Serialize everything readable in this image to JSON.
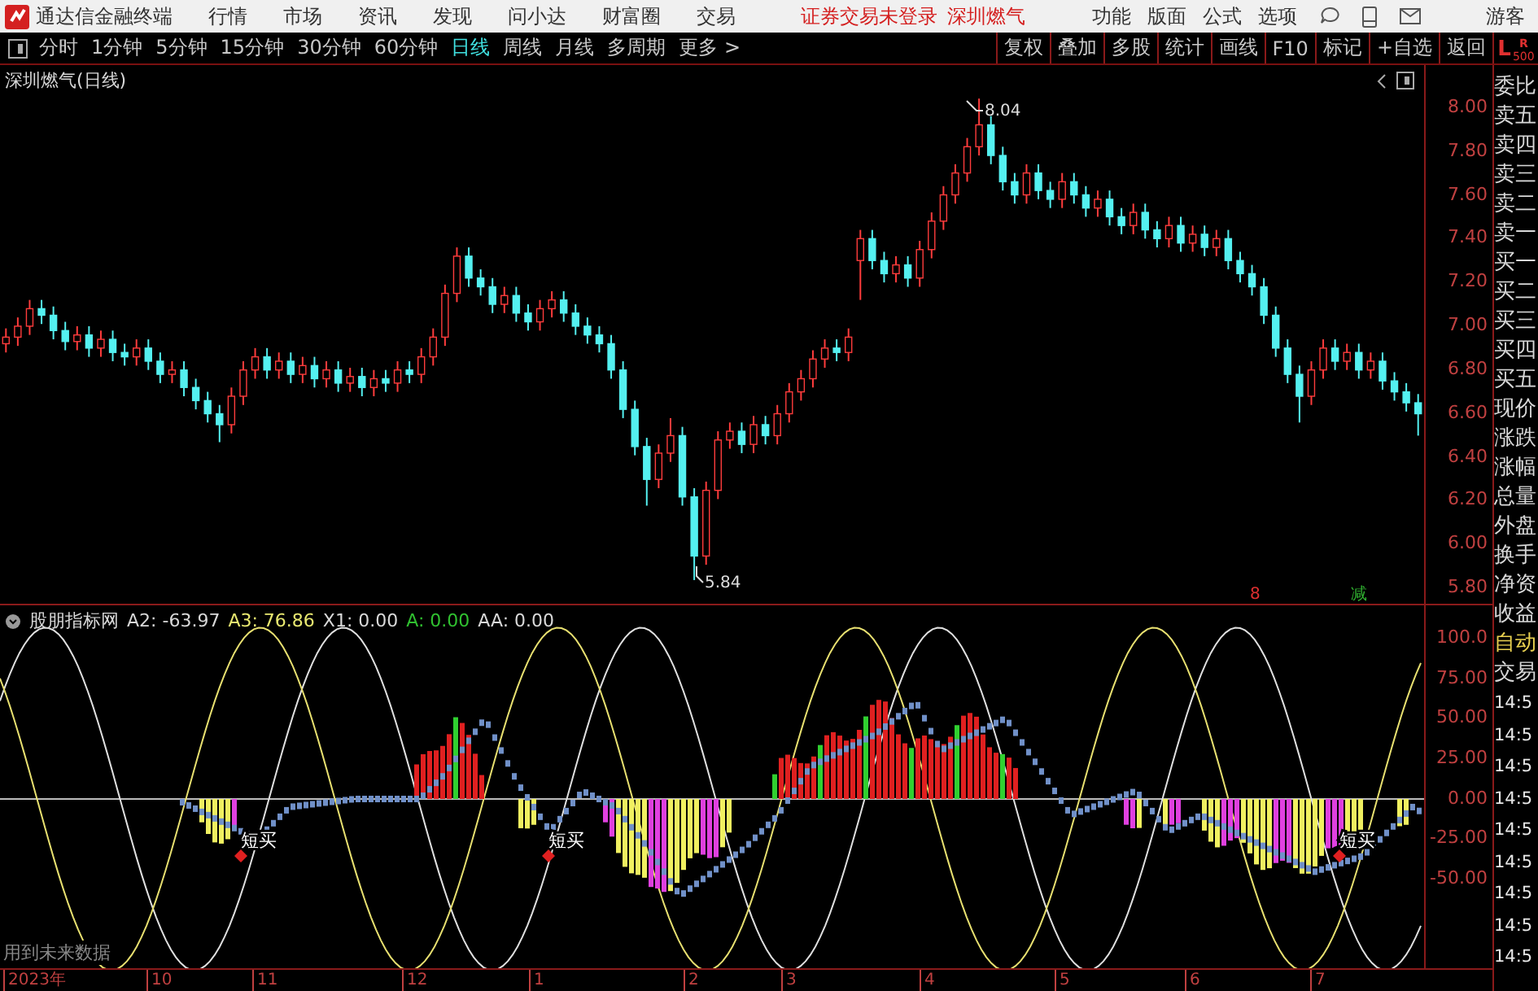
{
  "title_bar": {
    "app_name": "通达信金融终端",
    "menus": [
      "行情",
      "市场",
      "资讯",
      "发现",
      "问小达",
      "财富圈",
      "交易"
    ],
    "notice": "证券交易未登录",
    "stock": "深圳燃气",
    "tools": [
      "功能",
      "版面",
      "公式",
      "选项"
    ],
    "user": "游客"
  },
  "toolbar": {
    "periods": [
      {
        "label": "分时",
        "selected": false
      },
      {
        "label": "1分钟",
        "selected": false
      },
      {
        "label": "5分钟",
        "selected": false
      },
      {
        "label": "15分钟",
        "selected": false
      },
      {
        "label": "30分钟",
        "selected": false
      },
      {
        "label": "60分钟",
        "selected": false
      },
      {
        "label": "日线",
        "selected": true
      },
      {
        "label": "周线",
        "selected": false
      },
      {
        "label": "月线",
        "selected": false
      },
      {
        "label": "多周期",
        "selected": false
      },
      {
        "label": "更多 >",
        "selected": false
      }
    ],
    "actions": [
      "复权",
      "叠加",
      "多股",
      "统计",
      "画线",
      "F10",
      "标记",
      "+自选",
      "返回"
    ],
    "scale_mark": {
      "main": "L",
      "top": "R",
      "sub": "500"
    }
  },
  "price_chart": {
    "title": "深圳燃气(日线)",
    "chart_data": {
      "type": "candlestick",
      "ohlc": [
        [
          6.92,
          6.99,
          6.88,
          6.95
        ],
        [
          6.95,
          7.04,
          6.91,
          7.0
        ],
        [
          7.0,
          7.12,
          6.96,
          7.08
        ],
        [
          7.08,
          7.12,
          7.01,
          7.05
        ],
        [
          7.05,
          7.09,
          6.94,
          6.98
        ],
        [
          6.98,
          7.02,
          6.89,
          6.93
        ],
        [
          6.93,
          7.0,
          6.89,
          6.96
        ],
        [
          6.96,
          7.0,
          6.86,
          6.9
        ],
        [
          6.9,
          6.98,
          6.86,
          6.94
        ],
        [
          6.94,
          6.98,
          6.84,
          6.88
        ],
        [
          6.88,
          6.92,
          6.82,
          6.86
        ],
        [
          6.86,
          6.94,
          6.82,
          6.9
        ],
        [
          6.9,
          6.94,
          6.8,
          6.84
        ],
        [
          6.84,
          6.88,
          6.74,
          6.78
        ],
        [
          6.78,
          6.84,
          6.74,
          6.8
        ],
        [
          6.8,
          6.84,
          6.68,
          6.72
        ],
        [
          6.72,
          6.76,
          6.62,
          6.66
        ],
        [
          6.66,
          6.7,
          6.56,
          6.6
        ],
        [
          6.6,
          6.64,
          6.47,
          6.55
        ],
        [
          6.55,
          6.72,
          6.51,
          6.68
        ],
        [
          6.68,
          6.84,
          6.64,
          6.8
        ],
        [
          6.8,
          6.9,
          6.76,
          6.86
        ],
        [
          6.86,
          6.9,
          6.76,
          6.8
        ],
        [
          6.8,
          6.88,
          6.76,
          6.84
        ],
        [
          6.84,
          6.88,
          6.74,
          6.78
        ],
        [
          6.78,
          6.86,
          6.74,
          6.82
        ],
        [
          6.82,
          6.86,
          6.72,
          6.76
        ],
        [
          6.76,
          6.84,
          6.72,
          6.8
        ],
        [
          6.8,
          6.84,
          6.7,
          6.74
        ],
        [
          6.74,
          6.81,
          6.7,
          6.77
        ],
        [
          6.77,
          6.81,
          6.68,
          6.72
        ],
        [
          6.72,
          6.8,
          6.68,
          6.76
        ],
        [
          6.76,
          6.8,
          6.7,
          6.74
        ],
        [
          6.74,
          6.84,
          6.7,
          6.8
        ],
        [
          6.8,
          6.84,
          6.74,
          6.78
        ],
        [
          6.78,
          6.9,
          6.74,
          6.86
        ],
        [
          6.86,
          6.99,
          6.82,
          6.95
        ],
        [
          6.95,
          7.19,
          6.91,
          7.15
        ],
        [
          7.15,
          7.36,
          7.11,
          7.32
        ],
        [
          7.32,
          7.36,
          7.18,
          7.22
        ],
        [
          7.22,
          7.26,
          7.14,
          7.18
        ],
        [
          7.18,
          7.22,
          7.06,
          7.1
        ],
        [
          7.1,
          7.18,
          7.06,
          7.14
        ],
        [
          7.14,
          7.18,
          7.02,
          7.06
        ],
        [
          7.06,
          7.1,
          6.98,
          7.02
        ],
        [
          7.02,
          7.12,
          6.98,
          7.08
        ],
        [
          7.08,
          7.16,
          7.04,
          7.12
        ],
        [
          7.12,
          7.16,
          7.02,
          7.06
        ],
        [
          7.06,
          7.1,
          6.96,
          7.0
        ],
        [
          7.0,
          7.04,
          6.92,
          6.96
        ],
        [
          6.96,
          7.0,
          6.88,
          6.92
        ],
        [
          6.92,
          6.96,
          6.76,
          6.8
        ],
        [
          6.8,
          6.84,
          6.58,
          6.62
        ],
        [
          6.62,
          6.66,
          6.41,
          6.45
        ],
        [
          6.45,
          6.49,
          6.18,
          6.3
        ],
        [
          6.3,
          6.46,
          6.26,
          6.42
        ],
        [
          6.42,
          6.58,
          6.38,
          6.5
        ],
        [
          6.5,
          6.54,
          6.18,
          6.22
        ],
        [
          6.22,
          6.26,
          5.84,
          5.95
        ],
        [
          5.95,
          6.29,
          5.91,
          6.25
        ],
        [
          6.25,
          6.52,
          6.21,
          6.48
        ],
        [
          6.48,
          6.56,
          6.44,
          6.52
        ],
        [
          6.52,
          6.56,
          6.42,
          6.46
        ],
        [
          6.46,
          6.59,
          6.42,
          6.55
        ],
        [
          6.55,
          6.59,
          6.46,
          6.5
        ],
        [
          6.5,
          6.64,
          6.46,
          6.6
        ],
        [
          6.6,
          6.74,
          6.56,
          6.7
        ],
        [
          6.7,
          6.8,
          6.66,
          6.76
        ],
        [
          6.76,
          6.89,
          6.72,
          6.85
        ],
        [
          6.85,
          6.94,
          6.81,
          6.9
        ],
        [
          6.9,
          6.94,
          6.84,
          6.88
        ],
        [
          6.88,
          6.99,
          6.84,
          6.95
        ],
        [
          7.3,
          7.44,
          7.12,
          7.4
        ],
        [
          7.4,
          7.44,
          7.26,
          7.3
        ],
        [
          7.3,
          7.34,
          7.2,
          7.24
        ],
        [
          7.24,
          7.32,
          7.2,
          7.28
        ],
        [
          7.28,
          7.32,
          7.18,
          7.22
        ],
        [
          7.22,
          7.39,
          7.18,
          7.35
        ],
        [
          7.35,
          7.52,
          7.31,
          7.48
        ],
        [
          7.48,
          7.64,
          7.44,
          7.6
        ],
        [
          7.6,
          7.74,
          7.56,
          7.7
        ],
        [
          7.7,
          7.86,
          7.66,
          7.82
        ],
        [
          7.82,
          8.04,
          7.78,
          7.92
        ],
        [
          7.92,
          7.96,
          7.74,
          7.78
        ],
        [
          7.78,
          7.82,
          7.62,
          7.66
        ],
        [
          7.66,
          7.7,
          7.56,
          7.6
        ],
        [
          7.6,
          7.74,
          7.56,
          7.7
        ],
        [
          7.7,
          7.74,
          7.58,
          7.62
        ],
        [
          7.62,
          7.66,
          7.54,
          7.58
        ],
        [
          7.58,
          7.7,
          7.54,
          7.66
        ],
        [
          7.66,
          7.7,
          7.56,
          7.6
        ],
        [
          7.6,
          7.64,
          7.5,
          7.54
        ],
        [
          7.54,
          7.62,
          7.5,
          7.58
        ],
        [
          7.58,
          7.62,
          7.46,
          7.5
        ],
        [
          7.5,
          7.54,
          7.42,
          7.46
        ],
        [
          7.46,
          7.56,
          7.42,
          7.52
        ],
        [
          7.52,
          7.56,
          7.4,
          7.44
        ],
        [
          7.44,
          7.48,
          7.36,
          7.4
        ],
        [
          7.4,
          7.5,
          7.36,
          7.46
        ],
        [
          7.46,
          7.5,
          7.34,
          7.38
        ],
        [
          7.38,
          7.46,
          7.34,
          7.42
        ],
        [
          7.42,
          7.46,
          7.32,
          7.36
        ],
        [
          7.36,
          7.44,
          7.32,
          7.4
        ],
        [
          7.4,
          7.44,
          7.26,
          7.3
        ],
        [
          7.3,
          7.34,
          7.2,
          7.24
        ],
        [
          7.24,
          7.28,
          7.14,
          7.18
        ],
        [
          7.18,
          7.22,
          7.01,
          7.05
        ],
        [
          7.05,
          7.09,
          6.86,
          6.9
        ],
        [
          6.9,
          6.94,
          6.74,
          6.78
        ],
        [
          6.78,
          6.82,
          6.56,
          6.68
        ],
        [
          6.68,
          6.84,
          6.64,
          6.8
        ],
        [
          6.8,
          6.94,
          6.76,
          6.9
        ],
        [
          6.9,
          6.94,
          6.8,
          6.84
        ],
        [
          6.84,
          6.92,
          6.8,
          6.88
        ],
        [
          6.88,
          6.92,
          6.76,
          6.8
        ],
        [
          6.8,
          6.88,
          6.76,
          6.84
        ],
        [
          6.84,
          6.88,
          6.71,
          6.75
        ],
        [
          6.75,
          6.79,
          6.66,
          6.7
        ],
        [
          6.7,
          6.74,
          6.61,
          6.65
        ],
        [
          6.65,
          6.69,
          6.5,
          6.6
        ]
      ]
    },
    "high_label": "8.04",
    "low_label": "5.84",
    "marks": [
      {
        "text": "8",
        "color": "#e03030"
      },
      {
        "text": "减",
        "color": "#30b030"
      }
    ],
    "axis": [
      "8.00",
      "7.80",
      "7.60",
      "7.40",
      "7.20",
      "7.00",
      "6.80",
      "6.60",
      "6.40",
      "6.20",
      "6.00",
      "5.80"
    ]
  },
  "indicator": {
    "name": "股朋指标网",
    "values": [
      {
        "text": "A2: -63.97",
        "color": "#d8d8d8"
      },
      {
        "text": "A3: 76.86",
        "color": "#e8e870"
      },
      {
        "text": "X1: 0.00",
        "color": "#d8d8d8"
      },
      {
        "text": "A: 0.00",
        "color": "#30c030"
      },
      {
        "text": "AA: 0.00",
        "color": "#d8d8d8"
      }
    ],
    "signals": [
      "短买",
      "短买",
      "短买"
    ],
    "axis": [
      "100.0",
      "75.00",
      "50.00",
      "25.00",
      "0.00",
      "-25.00",
      "-50.00"
    ],
    "note": "用到未来数据"
  },
  "time_axis": [
    "2023年",
    "10",
    "11",
    "12",
    "1",
    "2",
    "3",
    "4",
    "5",
    "6",
    "7"
  ],
  "side_panel": {
    "quote_rows": [
      "委比",
      "卖五",
      "卖四",
      "卖三",
      "卖二",
      "卖一",
      "买一",
      "买二",
      "买三",
      "买四",
      "买五",
      "现价",
      "涨跌",
      "涨幅",
      "总量",
      "外盘",
      "换手",
      "净资",
      "收益"
    ],
    "mode": "自动",
    "trade": "交易",
    "ticks": [
      "14:5",
      "14:5",
      "14:5",
      "14:5",
      "14:5",
      "14:5",
      "14:5",
      "14:5",
      "14:5"
    ]
  }
}
